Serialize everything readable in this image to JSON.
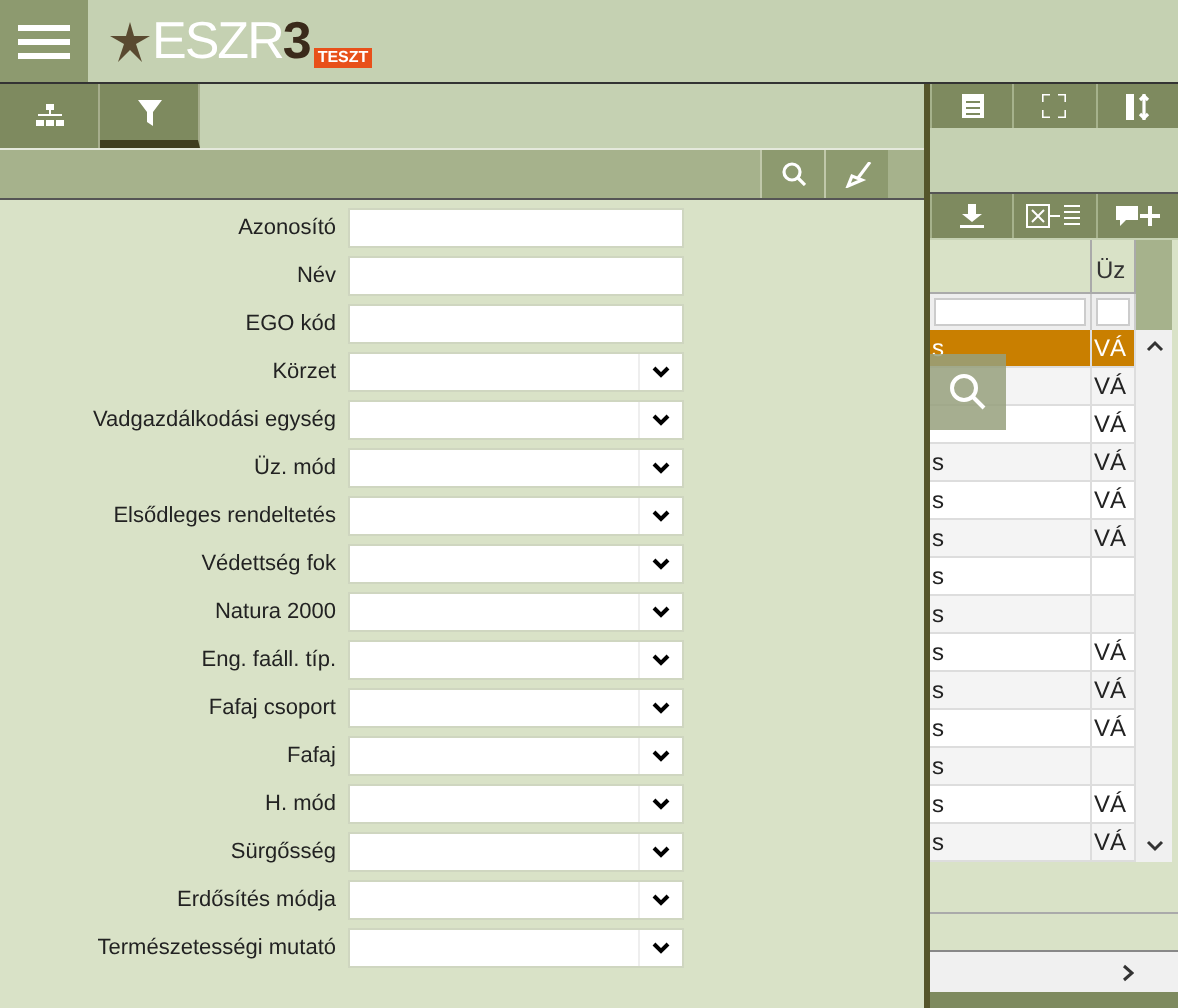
{
  "header": {
    "logo_text": "ESZR",
    "logo_digit": "3",
    "logo_badge": "TESZT"
  },
  "left_tabs": [
    {
      "kind": "tree",
      "selected": false
    },
    {
      "kind": "filter",
      "selected": true
    }
  ],
  "fields": [
    {
      "label": "Azonosító",
      "kind": "text"
    },
    {
      "label": "Név",
      "kind": "text"
    },
    {
      "label": "EGO kód",
      "kind": "text"
    },
    {
      "label": "Körzet",
      "kind": "select"
    },
    {
      "label": "Vadgazdálkodási egység",
      "kind": "select"
    },
    {
      "label": "Üz. mód",
      "kind": "select"
    },
    {
      "label": "Elsődleges rendeltetés",
      "kind": "select"
    },
    {
      "label": "Védettség fok",
      "kind": "select"
    },
    {
      "label": "Natura 2000",
      "kind": "select"
    },
    {
      "label": "Eng. faáll. típ.",
      "kind": "select"
    },
    {
      "label": "Fafaj csoport",
      "kind": "select"
    },
    {
      "label": "Fafaj",
      "kind": "select"
    },
    {
      "label": "H. mód",
      "kind": "select"
    },
    {
      "label": "Sürgősség",
      "kind": "select"
    },
    {
      "label": "Erdősítés módja",
      "kind": "select"
    },
    {
      "label": "Természetességi mutató",
      "kind": "select"
    }
  ],
  "grid": {
    "column_2": "Üz",
    "rows": [
      {
        "column_1": "s",
        "column_2": "VÁ",
        "selected": true
      },
      {
        "column_2": "VÁ",
        "selected": false
      },
      {
        "column_2": "VÁ",
        "selected": false
      },
      {
        "column_1": "s",
        "column_2": "VÁ",
        "selected": false
      },
      {
        "column_1": "s",
        "column_2": "VÁ",
        "selected": false
      },
      {
        "column_1": "s",
        "column_2": "VÁ",
        "selected": false
      },
      {
        "column_1": "s",
        "selected": false
      },
      {
        "column_1": "s",
        "selected": false
      },
      {
        "column_1": "s",
        "column_2": "VÁ",
        "selected": false
      },
      {
        "column_1": "s",
        "column_2": "VÁ",
        "selected": false
      },
      {
        "column_1": "s",
        "column_2": "VÁ",
        "selected": false
      },
      {
        "column_1": "s",
        "selected": false
      },
      {
        "column_1": "s",
        "column_2": "VÁ",
        "selected": false
      },
      {
        "column_1": "s",
        "column_2": "VÁ",
        "selected": false
      }
    ]
  }
}
